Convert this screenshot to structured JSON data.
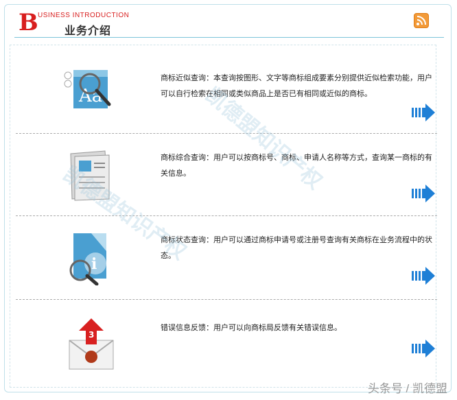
{
  "header": {
    "brand_letter": "B",
    "brand_en": "USINESS INTRODUCTION",
    "title": "业务介绍",
    "rss_icon": "rss-feed-icon"
  },
  "services": [
    {
      "icon": "magnify-text-icon",
      "description": "商标近似查询：本查询按图形、文字等商标组成要素分别提供近似检索功能，用户可以自行检索在相同或类似商品上是否已有相同或近似的商标。"
    },
    {
      "icon": "document-papers-icon",
      "description": "商标综合查询：用户可以按商标号、商标、申请人名称等方式，查询某一商标的有关信息。"
    },
    {
      "icon": "info-magnify-icon",
      "description": "商标状态查询：用户可以通过商标申请号或注册号查询有关商标在业务流程中的状态。"
    },
    {
      "icon": "mail-notification-icon",
      "description": "错误信息反馈：用户可以向商标局反馈有关错误信息。",
      "badge_count": "3"
    }
  ],
  "watermark": {
    "text_a": "凯德盟知识产权",
    "text_b": "凯德盟知识产权"
  },
  "corner_mark": "头条号 / 凯德盟",
  "colors": {
    "accent_red": "#d81e1e",
    "accent_blue": "#1e7fd6",
    "border": "#7cc4da"
  }
}
